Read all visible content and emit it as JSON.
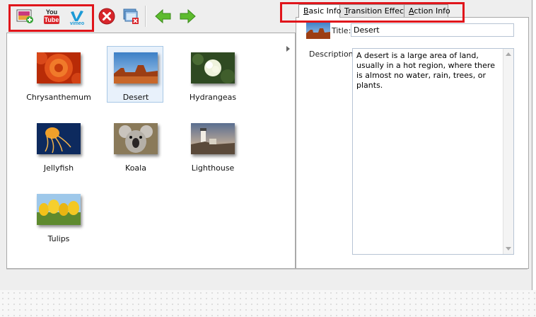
{
  "toolbar": {
    "buttons": [
      {
        "name": "add-image-button",
        "icon": "add-image-icon"
      },
      {
        "name": "youtube-button",
        "icon": "youtube-icon",
        "logo_text_top": "You",
        "logo_text_bottom": "Tube"
      },
      {
        "name": "vimeo-button",
        "icon": "vimeo-icon",
        "logo_text": "vimeo"
      },
      {
        "name": "remove-button",
        "icon": "remove-icon"
      },
      {
        "name": "delete-photos-button",
        "icon": "delete-photos-icon"
      },
      {
        "name": "move-left-button",
        "icon": "arrow-left-icon"
      },
      {
        "name": "move-right-button",
        "icon": "arrow-right-icon"
      }
    ]
  },
  "gallery": {
    "items": [
      {
        "label": "Chrysanthemum",
        "selected": false
      },
      {
        "label": "Desert",
        "selected": true
      },
      {
        "label": "Hydrangeas",
        "selected": false
      },
      {
        "label": "Jellyfish",
        "selected": false
      },
      {
        "label": "Koala",
        "selected": false
      },
      {
        "label": "Lighthouse",
        "selected": false
      },
      {
        "label": "Tulips",
        "selected": false
      }
    ]
  },
  "tabs": [
    {
      "label": "Basic Info",
      "mnemonic": "B",
      "rest": "asic Info",
      "active": true
    },
    {
      "label": "Transition Effect",
      "mnemonic": "T",
      "rest": "ransition Effect",
      "active": false
    },
    {
      "label": "Action Info",
      "mnemonic": "A",
      "rest": "ction Info",
      "active": false
    }
  ],
  "basic_info": {
    "title_label": "Title:",
    "title_value": "Desert",
    "description_label": "Description:",
    "description_value": "A desert is a large area of land, usually in a hot region, where there is almost no water, rain, trees, or plants."
  },
  "colors": {
    "highlight_border": "#e0151b",
    "selection_bg": "#e8f1fb",
    "arrow_green": "#4caf2a",
    "remove_red": "#d8262b"
  }
}
